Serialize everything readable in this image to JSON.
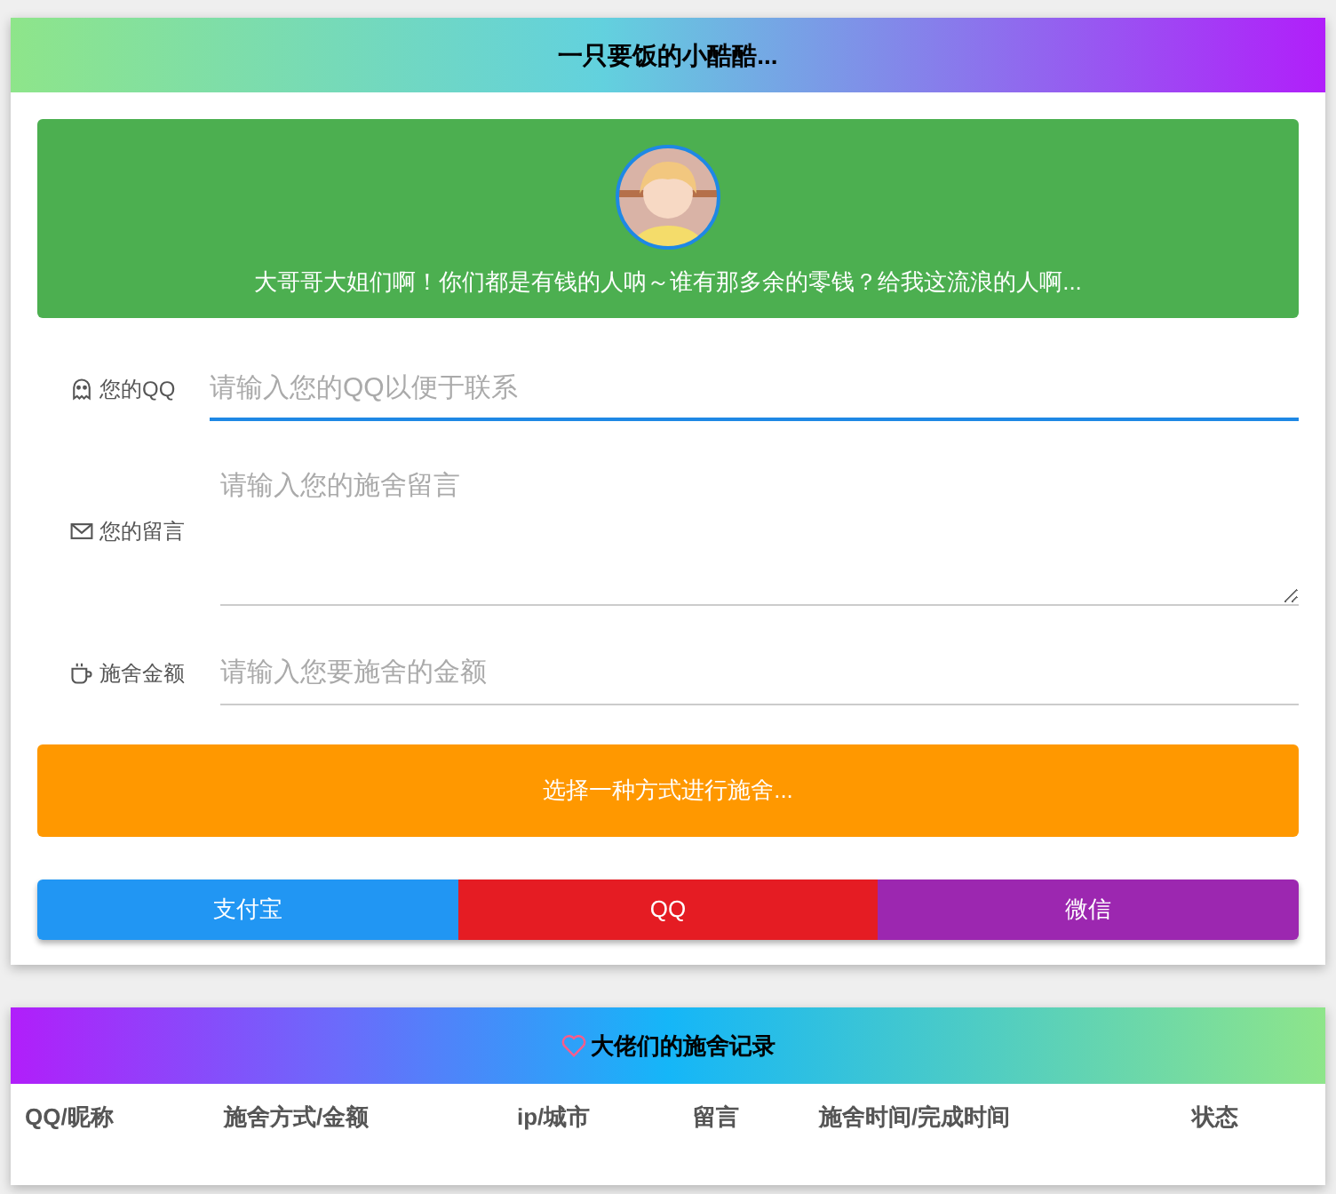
{
  "donate_card": {
    "title": "一只要饭的小酷酷...",
    "banner": {
      "message": "大哥哥大姐们啊！你们都是有钱的人呐～谁有那多余的零钱？给我这流浪的人啊..."
    },
    "fields": [
      {
        "kind": "input",
        "label": "您的QQ",
        "placeholder": "请输入您的QQ以便于联系",
        "focused": true
      },
      {
        "kind": "textarea",
        "label": "您的留言",
        "placeholder": "请输入您的施舍留言",
        "focused": false
      },
      {
        "kind": "input",
        "label": "施舍金额",
        "placeholder": "请输入您要施舍的金额",
        "focused": false
      }
    ],
    "prompt_button": "选择一种方式进行施舍...",
    "payment_buttons": [
      {
        "label": "支付宝",
        "color": "#2196f3"
      },
      {
        "label": "QQ",
        "color": "#e51c23"
      },
      {
        "label": "微信",
        "color": "#9c27b0"
      }
    ]
  },
  "records_card": {
    "title": "大佬们的施舍记录",
    "columns": [
      "QQ/昵称",
      "施舍方式/金额",
      "ip/城市",
      "留言",
      "施舍时间/完成时间",
      "状态"
    ]
  }
}
